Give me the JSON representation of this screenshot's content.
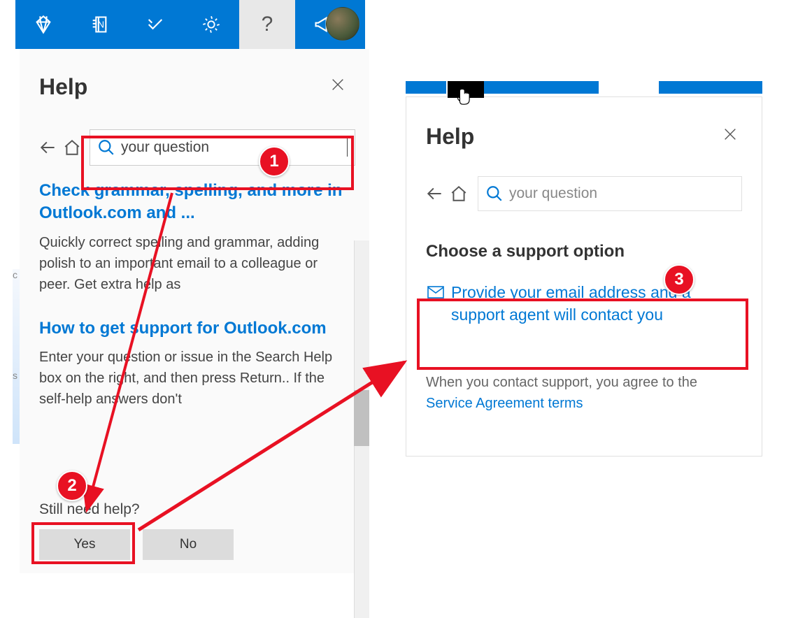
{
  "panelTitle": "Help",
  "search": {
    "value": "your question",
    "placeholder": "your question"
  },
  "results": [
    {
      "title": "Check grammar, spelling, and more in Outlook.com and ...",
      "desc": "Quickly correct spelling and grammar, adding polish to an important email to a colleague or peer. Get extra help as"
    },
    {
      "title": "How to get support for Outlook.com",
      "desc": "Enter your question or issue in the Search Help box on the right, and then press Return.. If the self-help answers don't"
    }
  ],
  "stillNeedHelp": {
    "label": "Still need help?",
    "yes": "Yes",
    "no": "No"
  },
  "rightPanel": {
    "title": "Help",
    "supportHeading": "Choose a support option",
    "supportOption": "Provide your email address and a support agent will contact you",
    "termsPrefix": "When you contact support, you agree to the ",
    "termsLink": "Service Agreement terms"
  },
  "badges": {
    "b1": "1",
    "b2": "2",
    "b3": "3"
  }
}
